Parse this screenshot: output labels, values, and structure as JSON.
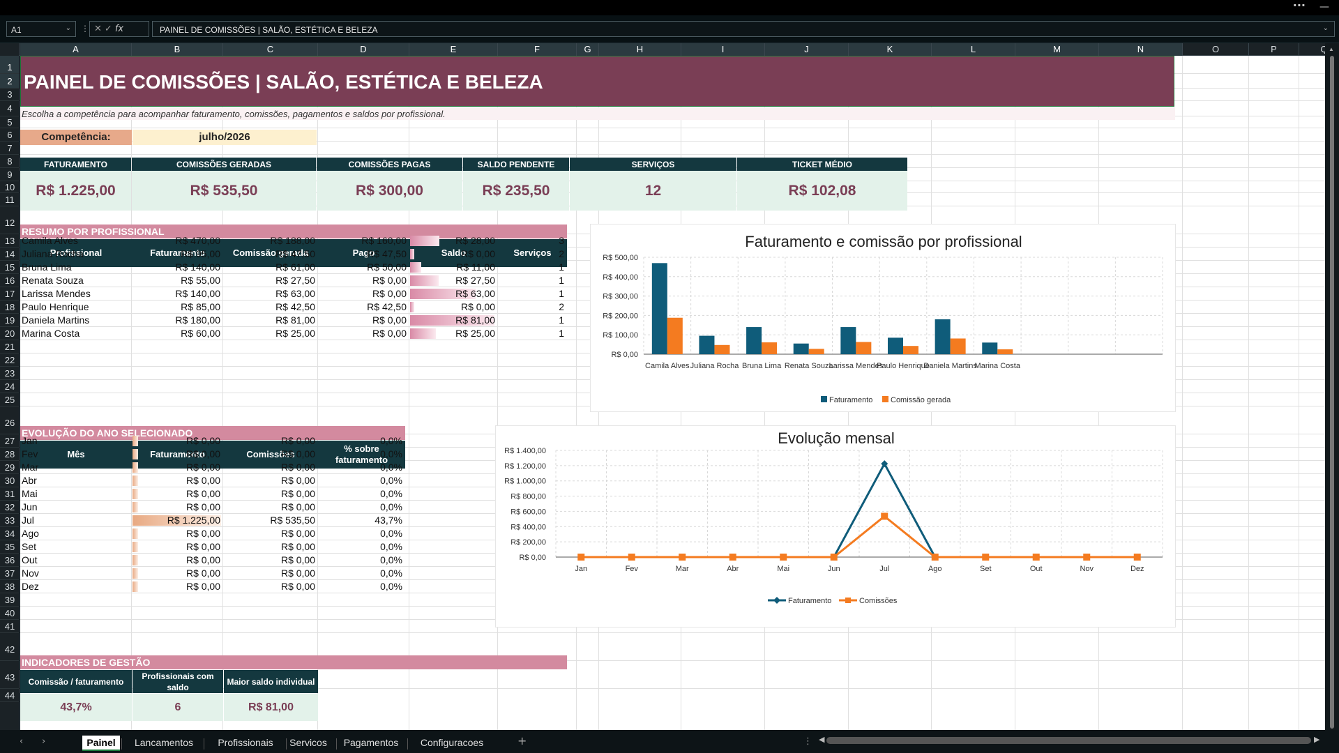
{
  "formula_bar": {
    "cell_ref": "A1",
    "formula": "PAINEL DE COMISSÕES | SALÃO, ESTÉTICA E BELEZA",
    "fx": "fx"
  },
  "columns": [
    "A",
    "B",
    "C",
    "D",
    "E",
    "F",
    "G",
    "H",
    "I",
    "J",
    "K",
    "L",
    "M",
    "N",
    "O",
    "P",
    "Q"
  ],
  "rows": [
    "1",
    "2",
    "3",
    "4",
    "5",
    "6",
    "7",
    "8",
    "9",
    "10",
    "11",
    "12",
    "13",
    "14",
    "15",
    "16",
    "17",
    "18",
    "19",
    "20",
    "21",
    "22",
    "23",
    "24",
    "25",
    "26",
    "27",
    "28",
    "29",
    "30",
    "31",
    "32",
    "33",
    "34",
    "35",
    "36",
    "37",
    "38",
    "39",
    "40",
    "41",
    "42",
    "43",
    "44"
  ],
  "header": {
    "title": "PAINEL DE COMISSÕES | SALÃO, ESTÉTICA E BELEZA",
    "subtitle": "Escolha a competência para acompanhar faturamento, comissões, pagamentos e saldos por profissional.",
    "competencia_label": "Competência:",
    "competencia_value": "julho/2026"
  },
  "kpis": [
    {
      "label": "FATURAMENTO",
      "value": "R$ 1.225,00"
    },
    {
      "label": "COMISSÕES GERADAS",
      "value": "R$ 535,50"
    },
    {
      "label": "COMISSÕES PAGAS",
      "value": "R$ 300,00"
    },
    {
      "label": "SALDO PENDENTE",
      "value": "R$ 235,50"
    },
    {
      "label": "SERVIÇOS",
      "value": "12"
    },
    {
      "label": "TICKET MÉDIO",
      "value": "R$ 102,08"
    }
  ],
  "resumo": {
    "title": "RESUMO POR PROFISSIONAL",
    "headers": [
      "Profissional",
      "Faturamento",
      "Comissão gerada",
      "Pago",
      "Saldo",
      "Serviços"
    ],
    "rows": [
      {
        "nome": "Camila Alves",
        "fat": "R$ 470,00",
        "com": "R$ 188,00",
        "pago": "R$ 160,00",
        "saldo": "R$ 28,00",
        "saldo_num": 28,
        "serv": "3"
      },
      {
        "nome": "Juliana Rocha",
        "fat": "R$ 95,00",
        "com": "R$ 47,50",
        "pago": "R$ 47,50",
        "saldo": "R$ 0,00",
        "saldo_num": 0,
        "serv": "2"
      },
      {
        "nome": "Bruna Lima",
        "fat": "R$ 140,00",
        "com": "R$ 61,00",
        "pago": "R$ 50,00",
        "saldo": "R$ 11,00",
        "saldo_num": 11,
        "serv": "1"
      },
      {
        "nome": "Renata Souza",
        "fat": "R$ 55,00",
        "com": "R$ 27,50",
        "pago": "R$ 0,00",
        "saldo": "R$ 27,50",
        "saldo_num": 27.5,
        "serv": "1"
      },
      {
        "nome": "Larissa Mendes",
        "fat": "R$ 140,00",
        "com": "R$ 63,00",
        "pago": "R$ 0,00",
        "saldo": "R$ 63,00",
        "saldo_num": 63,
        "serv": "1"
      },
      {
        "nome": "Paulo Henrique",
        "fat": "R$ 85,00",
        "com": "R$ 42,50",
        "pago": "R$ 42,50",
        "saldo": "R$ 0,00",
        "saldo_num": 0,
        "serv": "2"
      },
      {
        "nome": "Daniela Martins",
        "fat": "R$ 180,00",
        "com": "R$ 81,00",
        "pago": "R$ 0,00",
        "saldo": "R$ 81,00",
        "saldo_num": 81,
        "serv": "1"
      },
      {
        "nome": "Marina Costa",
        "fat": "R$ 60,00",
        "com": "R$ 25,00",
        "pago": "R$ 0,00",
        "saldo": "R$ 25,00",
        "saldo_num": 25,
        "serv": "1"
      }
    ]
  },
  "evolucao": {
    "title": "EVOLUÇÃO DO ANO SELECIONADO",
    "headers": [
      "Mês",
      "Faturamento",
      "Comissões",
      "% sobre faturamento"
    ],
    "rows": [
      {
        "mes": "Jan",
        "fat": "R$ 0,00",
        "fat_num": 0,
        "com": "R$ 0,00",
        "pct": "0,0%"
      },
      {
        "mes": "Fev",
        "fat": "R$ 0,00",
        "fat_num": 0,
        "com": "R$ 0,00",
        "pct": "0,0%"
      },
      {
        "mes": "Mar",
        "fat": "R$ 0,00",
        "fat_num": 0,
        "com": "R$ 0,00",
        "pct": "0,0%"
      },
      {
        "mes": "Abr",
        "fat": "R$ 0,00",
        "fat_num": 0,
        "com": "R$ 0,00",
        "pct": "0,0%"
      },
      {
        "mes": "Mai",
        "fat": "R$ 0,00",
        "fat_num": 0,
        "com": "R$ 0,00",
        "pct": "0,0%"
      },
      {
        "mes": "Jun",
        "fat": "R$ 0,00",
        "fat_num": 0,
        "com": "R$ 0,00",
        "pct": "0,0%"
      },
      {
        "mes": "Jul",
        "fat": "R$ 1.225,00",
        "fat_num": 1225,
        "com": "R$ 535,50",
        "pct": "43,7%"
      },
      {
        "mes": "Ago",
        "fat": "R$ 0,00",
        "fat_num": 0,
        "com": "R$ 0,00",
        "pct": "0,0%"
      },
      {
        "mes": "Set",
        "fat": "R$ 0,00",
        "fat_num": 0,
        "com": "R$ 0,00",
        "pct": "0,0%"
      },
      {
        "mes": "Out",
        "fat": "R$ 0,00",
        "fat_num": 0,
        "com": "R$ 0,00",
        "pct": "0,0%"
      },
      {
        "mes": "Nov",
        "fat": "R$ 0,00",
        "fat_num": 0,
        "com": "R$ 0,00",
        "pct": "0,0%"
      },
      {
        "mes": "Dez",
        "fat": "R$ 0,00",
        "fat_num": 0,
        "com": "R$ 0,00",
        "pct": "0,0%"
      }
    ]
  },
  "indicadores": {
    "title": "INDICADORES DE GESTÃO",
    "items": [
      {
        "label": "Comissão / faturamento",
        "value": "43,7%"
      },
      {
        "label": "Profissionais com saldo",
        "value": "6"
      },
      {
        "label": "Maior saldo individual",
        "value": "R$ 81,00"
      }
    ]
  },
  "tabs": [
    "Painel",
    "Lancamentos",
    "Profissionais",
    "Servicos",
    "Pagamentos",
    "Configuracoes"
  ],
  "active_tab": "Painel",
  "colors": {
    "primary": "#7a3e55",
    "header_dark": "#14383f",
    "section": "#d38a9f",
    "kpi_bg": "#e3f2ea",
    "series_fat": "#0f5c7a",
    "series_com": "#f47b20",
    "saldo_bar": "#d98aa6",
    "fat_bar": "#e8a982"
  },
  "chart_data": [
    {
      "type": "bar",
      "title": "Faturamento e comissão por profissional",
      "categories": [
        "Camila Alves",
        "Juliana Rocha",
        "Bruna Lima",
        "Renata Souza",
        "Larissa Mendes",
        "Paulo Henrique",
        "Daniela Martins",
        "Marina Costa"
      ],
      "series": [
        {
          "name": "Faturamento",
          "values": [
            470,
            95,
            140,
            55,
            140,
            85,
            180,
            60
          ]
        },
        {
          "name": "Comissão gerada",
          "values": [
            188,
            47.5,
            61,
            27.5,
            63,
            42.5,
            81,
            25
          ]
        }
      ],
      "yticks": [
        "R$ 0,00",
        "R$ 100,00",
        "R$ 200,00",
        "R$ 300,00",
        "R$ 400,00",
        "R$ 500,00"
      ],
      "ylim": [
        0,
        500
      ],
      "grid": true,
      "legend": "bottom"
    },
    {
      "type": "line",
      "title": "Evolução mensal",
      "categories": [
        "Jan",
        "Fev",
        "Mar",
        "Abr",
        "Mai",
        "Jun",
        "Jul",
        "Ago",
        "Set",
        "Out",
        "Nov",
        "Dez"
      ],
      "series": [
        {
          "name": "Faturamento",
          "values": [
            0,
            0,
            0,
            0,
            0,
            0,
            1225,
            0,
            0,
            0,
            0,
            0
          ]
        },
        {
          "name": "Comissões",
          "values": [
            0,
            0,
            0,
            0,
            0,
            0,
            535.5,
            0,
            0,
            0,
            0,
            0
          ]
        }
      ],
      "yticks": [
        "R$ 0,00",
        "R$ 200,00",
        "R$ 400,00",
        "R$ 600,00",
        "R$ 800,00",
        "R$ 1.000,00",
        "R$ 1.200,00",
        "R$ 1.400,00"
      ],
      "ylim": [
        0,
        1400
      ],
      "grid": true,
      "legend": "bottom"
    }
  ]
}
